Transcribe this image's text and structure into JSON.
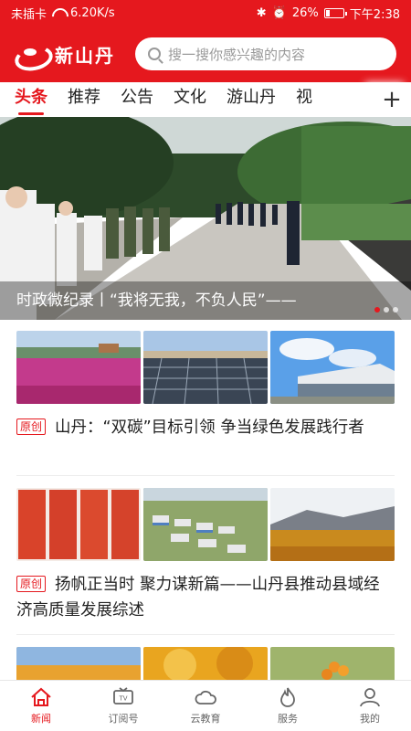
{
  "status_bar": {
    "carrier": "未插卡",
    "speed": "6.20K/s",
    "battery": "26%",
    "battery_level": 0.26,
    "time": "下午2:38"
  },
  "header": {
    "app_name": "新山丹",
    "search_placeholder": "搜一搜你感兴趣的内容"
  },
  "tabs": {
    "items": [
      "头条",
      "推荐",
      "公告",
      "文化",
      "游山丹",
      "视"
    ],
    "active_index": 0,
    "more_label": "+"
  },
  "banner": {
    "caption": "时政微纪录丨“我将无我，不负人民”——",
    "slide_count": 3,
    "active_slide": 0
  },
  "articles": [
    {
      "tag": "原创",
      "title": "山丹：“双碳”目标引领  争当绿色发展践行者"
    },
    {
      "tag": "原创",
      "title": "扬帆正当时  聚力谋新篇——山丹县推动县域经济高质量发展综述"
    }
  ],
  "bottom_nav": {
    "items": [
      "新闻",
      "订阅号",
      "云教育",
      "服务",
      "我的"
    ],
    "active_index": 0
  },
  "colors": {
    "brand_red": "#e5181e"
  }
}
